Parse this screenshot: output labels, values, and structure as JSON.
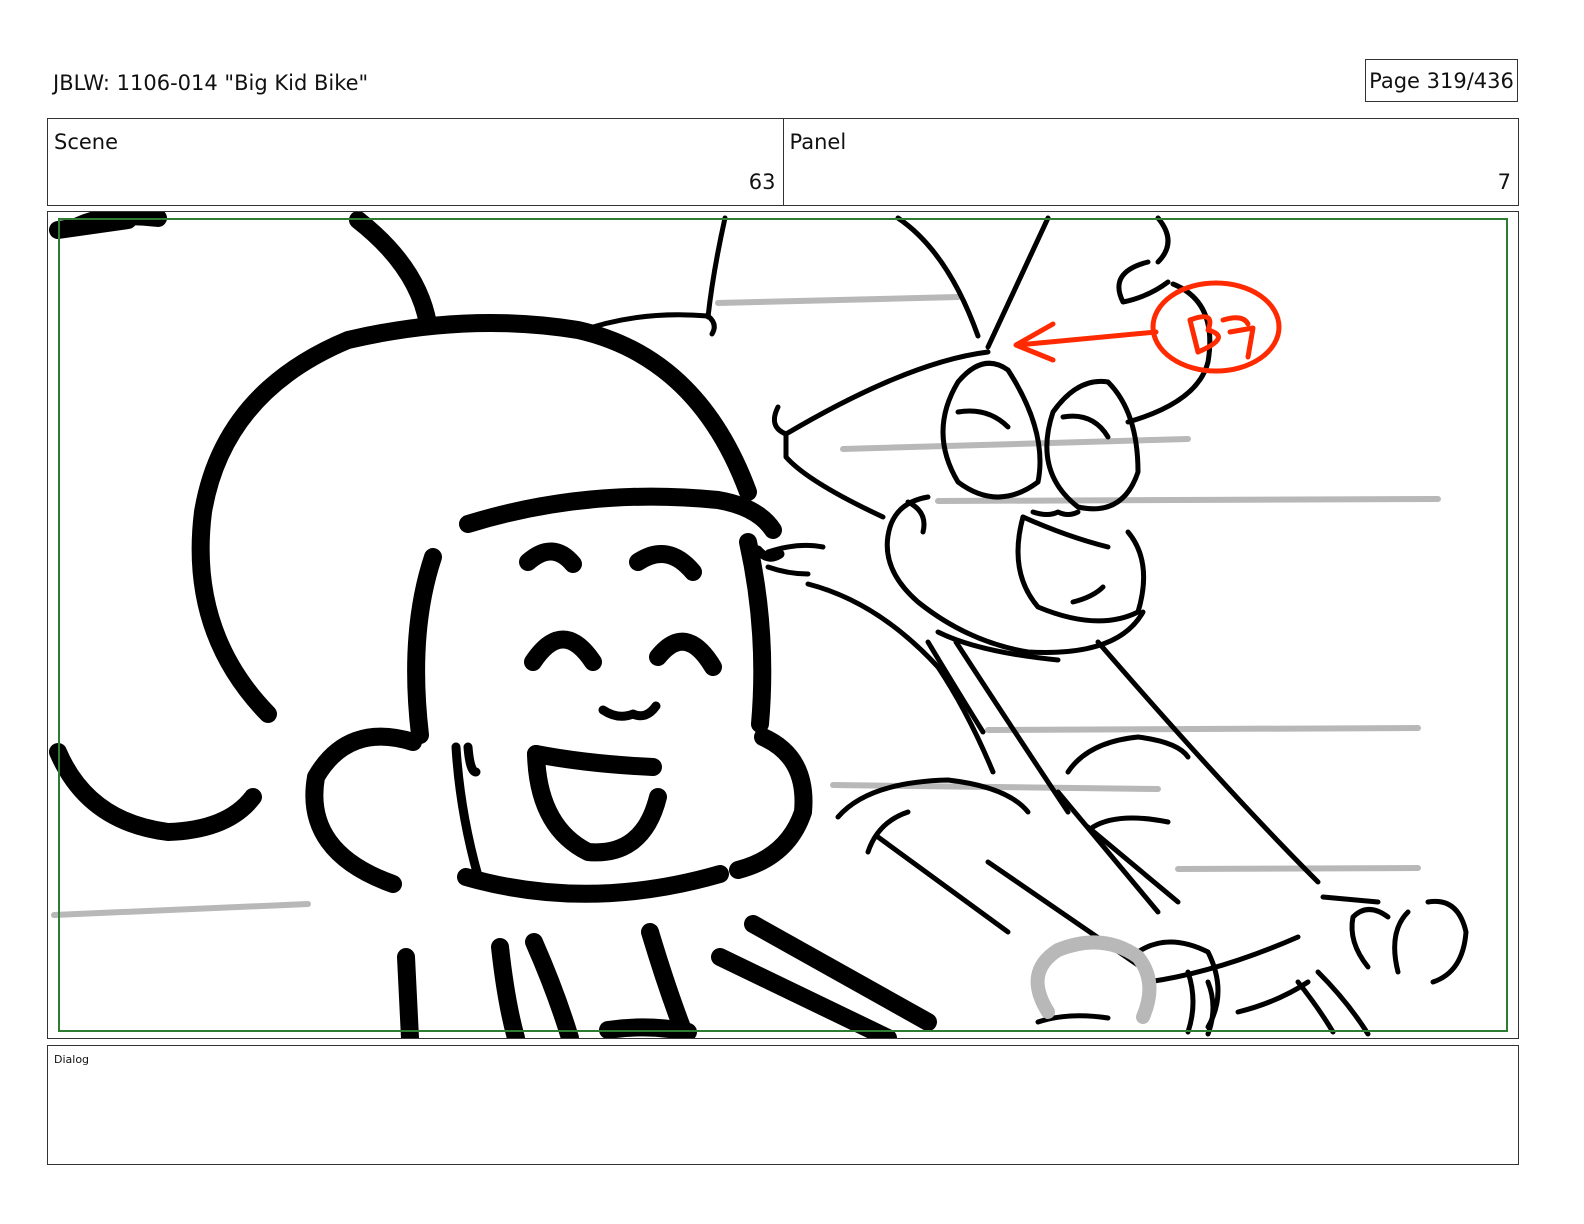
{
  "header": {
    "title": "JBLW: 1106-014 \"Big Kid Bike\"",
    "page": "Page 319/436"
  },
  "scene": {
    "label": "Scene",
    "value": "63"
  },
  "panel": {
    "label": "Panel",
    "value": "7",
    "sketch_note": "BG"
  },
  "dialog": {
    "label": "Dialog",
    "text": ""
  },
  "colors": {
    "ink": "#000000",
    "speed_lines": "#b8b8b8",
    "safe_frame": "#2e7d32",
    "annotation": "#ff2a00"
  }
}
